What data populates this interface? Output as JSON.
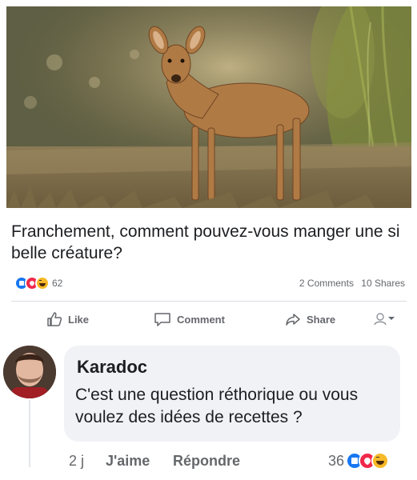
{
  "post": {
    "caption": "Franchement, comment pouvez-vous manger une si belle créature?",
    "photo_icon": "deer-photo",
    "reaction_count": "62",
    "comments": "2 Comments",
    "shares": "10 Shares"
  },
  "actions": {
    "like_label": "Like",
    "comment_label": "Comment",
    "share_label": "Share"
  },
  "comment": {
    "author": "Karadoc",
    "text": "C'est une question réthorique ou vous voulez des idées de recettes ?",
    "time": "2 j",
    "like_label": "J'aime",
    "reply_label": "Répondre",
    "reaction_count": "36"
  },
  "colors": {
    "like_blue": "#1877f2",
    "love_red": "#f0284a",
    "haha_yellow": "#f7b928",
    "bubble_grey": "#f0f2f5",
    "secondary_text": "#65676b"
  }
}
